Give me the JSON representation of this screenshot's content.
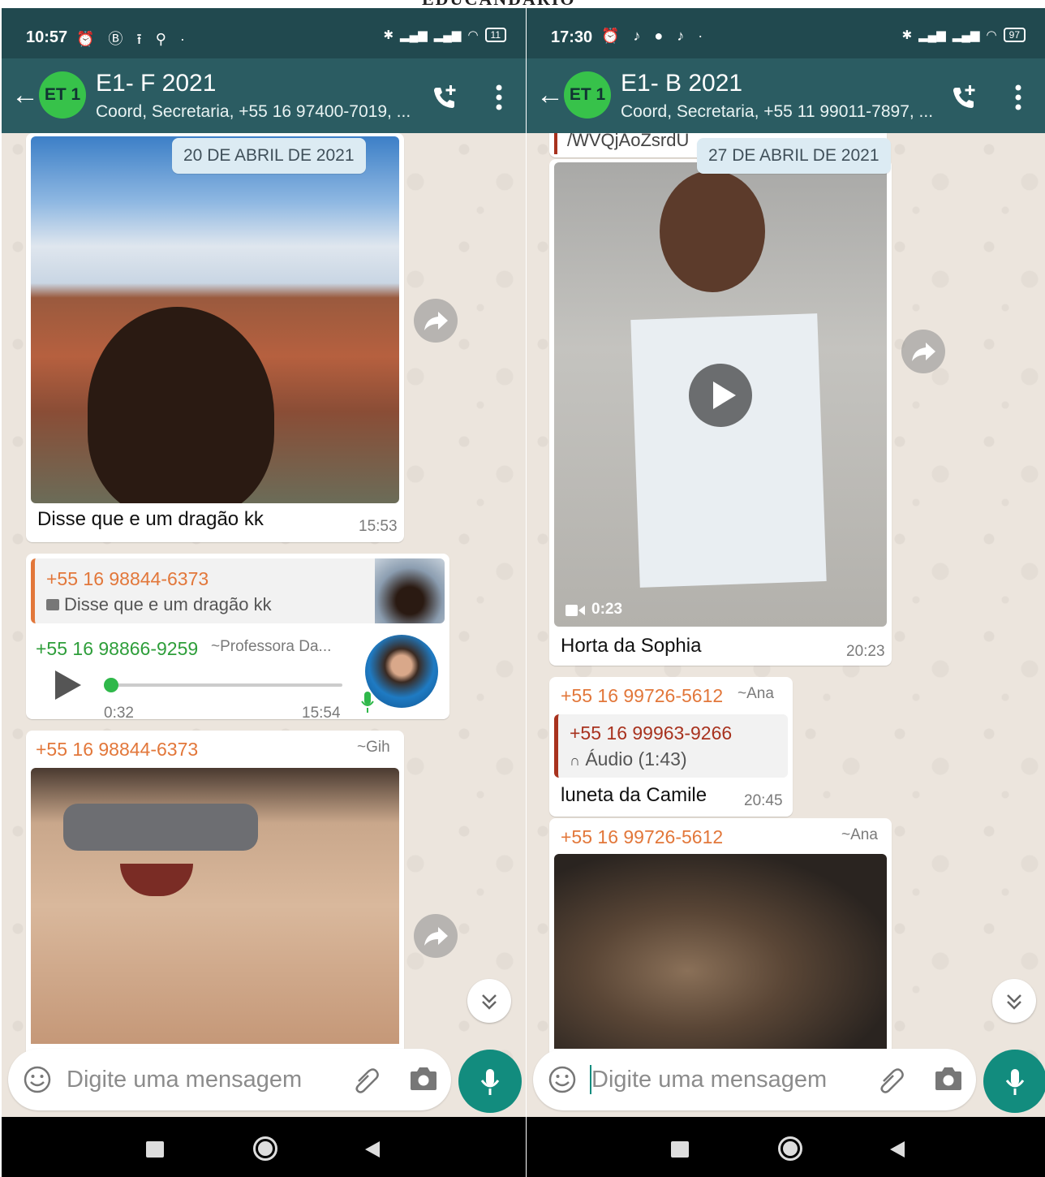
{
  "watermark": "EDUCANDARIO",
  "left": {
    "status": {
      "time": "10:57",
      "battery": "11"
    },
    "header": {
      "avatar": "ET 1",
      "title": "E1- F 2021",
      "subtitle": "Coord, Secretaria, +55 16 97400-7019, ..."
    },
    "date_chip": "20 DE ABRIL DE 2021",
    "msg1": {
      "caption": "Disse que e um dragão kk",
      "time": "15:53"
    },
    "msg2": {
      "quote_sender": "+55 16 98844-6373",
      "quote_text": "Disse que e um dragão kk",
      "sender": "+55 16 98866-9259",
      "alias": "~Professora Da...",
      "audio_duration": "0:32",
      "time": "15:54",
      "audio_progress": 0.0
    },
    "msg3": {
      "sender": "+55 16 98844-6373",
      "alias": "~Gih"
    },
    "input": {
      "placeholder": "Digite uma mensagem"
    }
  },
  "right": {
    "status": {
      "time": "17:30",
      "battery": "97"
    },
    "header": {
      "avatar": "ET 1",
      "title": "E1- B 2021",
      "subtitle": "Coord, Secretaria, +55 11 99011-7897, ..."
    },
    "link_fragment": "/WVQjAoZsrdU",
    "date_chip": "27 DE ABRIL DE 2021",
    "msg1": {
      "video_duration": "0:23",
      "caption": "Horta da Sophia",
      "time": "20:23"
    },
    "msg2": {
      "sender": "+55 16 99726-5612",
      "alias": "~Ana",
      "quote_sender": "+55 16 99963-9266",
      "quote_text": "Áudio (1:43)",
      "caption": "luneta da Camile",
      "time": "20:45"
    },
    "msg3": {
      "sender": "+55 16 99726-5612",
      "alias": "~Ana"
    },
    "input": {
      "placeholder": "Digite uma mensagem"
    }
  }
}
